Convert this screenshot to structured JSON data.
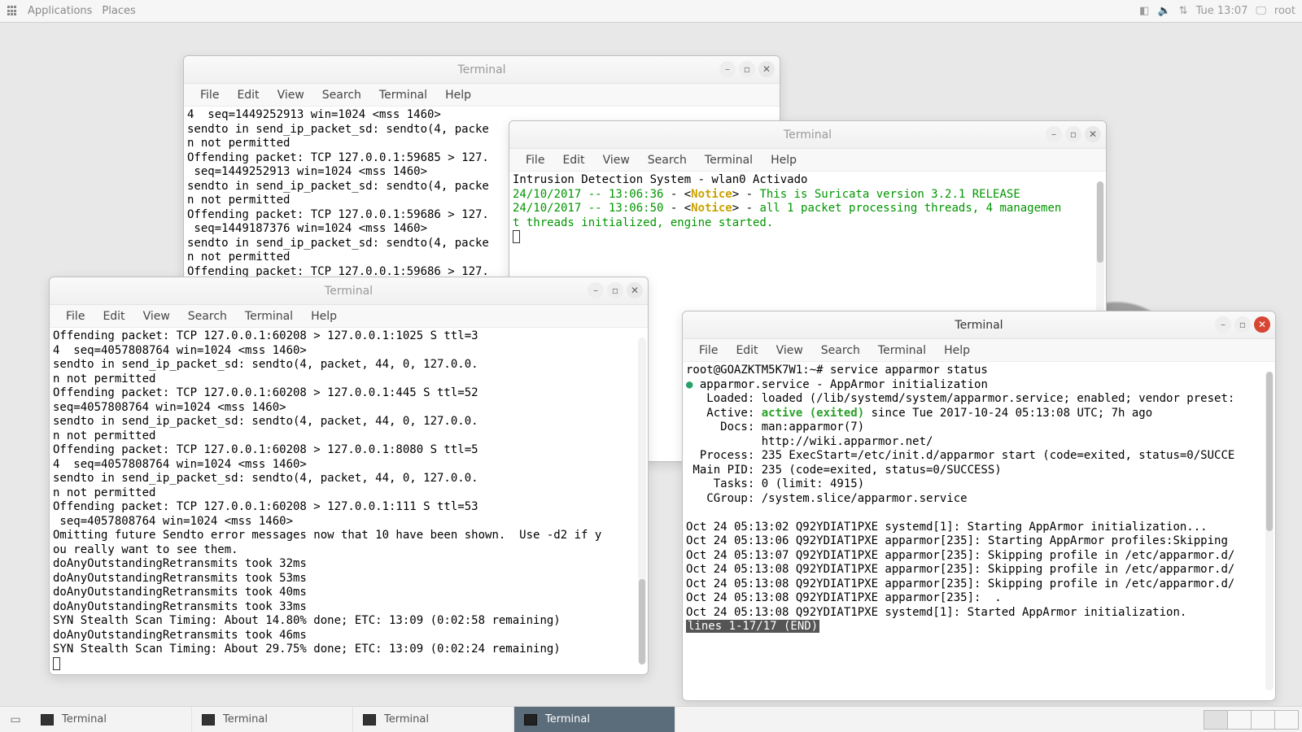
{
  "topbar": {
    "applications": "Applications",
    "places": "Places",
    "clock": "Tue 13:07",
    "user": "root"
  },
  "menus": {
    "file": "File",
    "edit": "Edit",
    "view": "View",
    "search": "Search",
    "terminal": "Terminal",
    "help": "Help"
  },
  "windows": {
    "term1": {
      "title": "Terminal",
      "content": "4  seq=1449252913 win=1024 <mss 1460>\nsendto in send_ip_packet_sd: sendto(4, packe\nn not permitted\nOffending packet: TCP 127.0.0.1:59685 > 127.\n seq=1449252913 win=1024 <mss 1460>\nsendto in send_ip_packet_sd: sendto(4, packe\nn not permitted\nOffending packet: TCP 127.0.0.1:59686 > 127.\n seq=1449187376 win=1024 <mss 1460>\nsendto in send_ip_packet_sd: sendto(4, packe\nn not permitted\nOffending packet: TCP 127.0.0.1:59686 > 127."
    },
    "term2": {
      "title": "Terminal",
      "header": "Intrusion Detection System - wlan0 Activado",
      "ts1": "24/10/2017 -- 13:06:36",
      "ts2": "24/10/2017 -- 13:06:50",
      "notice": "Notice",
      "msg1": "This is Suricata version 3.2.1 RELEASE",
      "msg2a": "all 1 packet processing threads, 4 managemen",
      "msg2b": "t threads initialized, engine started."
    },
    "term3": {
      "title": "Terminal",
      "content": "Offending packet: TCP 127.0.0.1:60208 > 127.0.0.1:1025 S ttl=3\n4  seq=4057808764 win=1024 <mss 1460>\nsendto in send_ip_packet_sd: sendto(4, packet, 44, 0, 127.0.0.\nn not permitted\nOffending packet: TCP 127.0.0.1:60208 > 127.0.0.1:445 S ttl=52\nseq=4057808764 win=1024 <mss 1460>\nsendto in send_ip_packet_sd: sendto(4, packet, 44, 0, 127.0.0.\nn not permitted\nOffending packet: TCP 127.0.0.1:60208 > 127.0.0.1:8080 S ttl=5\n4  seq=4057808764 win=1024 <mss 1460>\nsendto in send_ip_packet_sd: sendto(4, packet, 44, 0, 127.0.0.\nn not permitted\nOffending packet: TCP 127.0.0.1:60208 > 127.0.0.1:111 S ttl=53\n seq=4057808764 win=1024 <mss 1460>\nOmitting future Sendto error messages now that 10 have been shown.  Use -d2 if y\nou really want to see them.\ndoAnyOutstandingRetransmits took 32ms\ndoAnyOutstandingRetransmits took 53ms\ndoAnyOutstandingRetransmits took 40ms\ndoAnyOutstandingRetransmits took 33ms\nSYN Stealth Scan Timing: About 14.80% done; ETC: 13:09 (0:02:58 remaining)\ndoAnyOutstandingRetransmits took 46ms\nSYN Stealth Scan Timing: About 29.75% done; ETC: 13:09 (0:02:24 remaining)"
    },
    "term4": {
      "title": "Terminal",
      "prompt": "root@GOAZKTM5K7W1:~# service apparmor status",
      "svc_line": "apparmor.service - AppArmor initialization",
      "loaded": "   Loaded: loaded (/lib/systemd/system/apparmor.service; enabled; vendor preset:",
      "active_pre": "   Active: ",
      "active_green": "active (exited)",
      "active_post": " since Tue 2017-10-24 05:13:08 UTC; 7h ago",
      "docs1": "     Docs: man:apparmor(7)",
      "docs2": "           http://wiki.apparmor.net/",
      "process": "  Process: 235 ExecStart=/etc/init.d/apparmor start (code=exited, status=0/SUCCE",
      "mainpid": " Main PID: 235 (code=exited, status=0/SUCCESS)",
      "tasks": "    Tasks: 0 (limit: 4915)",
      "cgroup": "   CGroup: /system.slice/apparmor.service",
      "log1": "Oct 24 05:13:02 Q92YDIAT1PXE systemd[1]: Starting AppArmor initialization...",
      "log2": "Oct 24 05:13:06 Q92YDIAT1PXE apparmor[235]: Starting AppArmor profiles:Skipping",
      "log3": "Oct 24 05:13:07 Q92YDIAT1PXE apparmor[235]: Skipping profile in /etc/apparmor.d/",
      "log4": "Oct 24 05:13:08 Q92YDIAT1PXE apparmor[235]: Skipping profile in /etc/apparmor.d/",
      "log5": "Oct 24 05:13:08 Q92YDIAT1PXE apparmor[235]: Skipping profile in /etc/apparmor.d/",
      "log6": "Oct 24 05:13:08 Q92YDIAT1PXE apparmor[235]:  .",
      "log7": "Oct 24 05:13:08 Q92YDIAT1PXE systemd[1]: Started AppArmor initialization.",
      "pager": "lines 1-17/17 (END)"
    }
  },
  "taskbar": {
    "items": [
      {
        "label": "Terminal",
        "active": false
      },
      {
        "label": "Terminal",
        "active": false
      },
      {
        "label": "Terminal",
        "active": false
      },
      {
        "label": "Terminal",
        "active": true
      }
    ]
  }
}
